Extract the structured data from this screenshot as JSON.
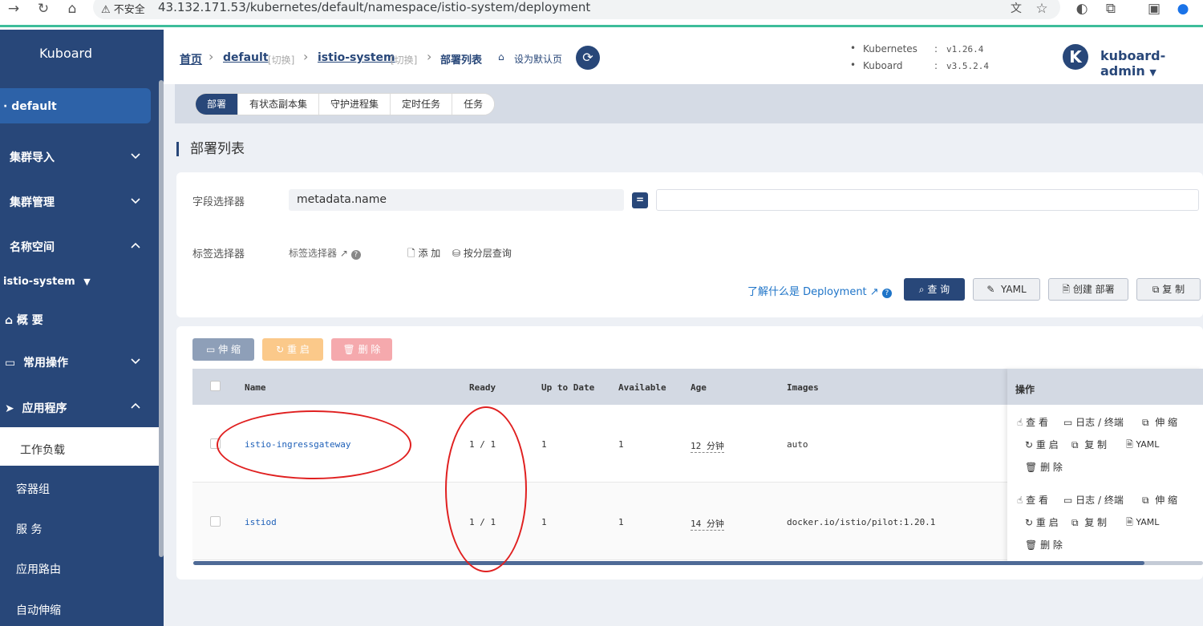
{
  "browser": {
    "insecure_label": "不安全",
    "url": "43.132.171.53/kubernetes/default/namespace/istio-system/deployment"
  },
  "sidebar": {
    "brand": "Kuboard",
    "cluster": "default",
    "items": [
      {
        "label": "集群导入"
      },
      {
        "label": "集群管理"
      },
      {
        "label": "名称空间"
      }
    ],
    "namespace": "istio-system",
    "overview": "概 要",
    "common_ops": "常用操作",
    "applications": "应用程序",
    "workloads": "工作负载",
    "sub_items": [
      "容器组",
      "服 务",
      "应用路由",
      "自动伸缩"
    ]
  },
  "header": {
    "crumb_home": "首页",
    "crumb_cluster": "default",
    "crumb_switch": "[切换]",
    "crumb_namespace": "istio-system",
    "crumb_page": "部署列表",
    "set_default": "设为默认页",
    "kubernetes_label": "Kubernetes",
    "kubernetes_version": "v1.26.4",
    "kuboard_label": "Kuboard",
    "kuboard_version": "v3.5.2.4",
    "colon": ":",
    "avatar_letter": "K",
    "user": "kuboard-admin"
  },
  "tabs": [
    "部署",
    "有状态副本集",
    "守护进程集",
    "定时任务",
    "任务"
  ],
  "page_title": "部署列表",
  "filter": {
    "field_selector_label": "字段选择器",
    "field_selector_value": "metadata.name",
    "operator": "=",
    "label_selector_label": "标签选择器",
    "label_selector_link": "标签选择器",
    "add": "添 加",
    "layered_query": "按分层查询",
    "learn": "了解什么是 Deployment",
    "query": "查 询",
    "yaml": "YAML",
    "create": "创建 部署",
    "copy": "复 制"
  },
  "actions": {
    "scale": "伸 缩",
    "restart": "重 启",
    "delete": "删 除"
  },
  "table": {
    "headers": [
      "Name",
      "Ready",
      "Up to Date",
      "Available",
      "Age",
      "Images",
      "操作"
    ],
    "rows": [
      {
        "name": "istio-ingressgateway",
        "ready": "1 / 1",
        "up_to_date": "1",
        "available": "1",
        "age": "12 分钟",
        "images": "auto"
      },
      {
        "name": "istiod",
        "ready": "1 / 1",
        "up_to_date": "1",
        "available": "1",
        "age": "14 分钟",
        "images": "docker.io/istio/pilot:1.20.1"
      }
    ],
    "ops": {
      "view": "查 看",
      "logs": "日志 / 终端",
      "scale": "伸 缩",
      "restart": "重 启",
      "copy": "复 制",
      "yaml": "YAML",
      "delete": "删 除"
    }
  },
  "colors": {
    "primary": "#284779",
    "sidebar_active": "#2d62a8",
    "link": "#1e60b8",
    "annotation": "#e02020",
    "restart_btn": "#fbc98a",
    "delete_btn": "#f5a9ad",
    "scale_btn": "#8e9fb8"
  }
}
